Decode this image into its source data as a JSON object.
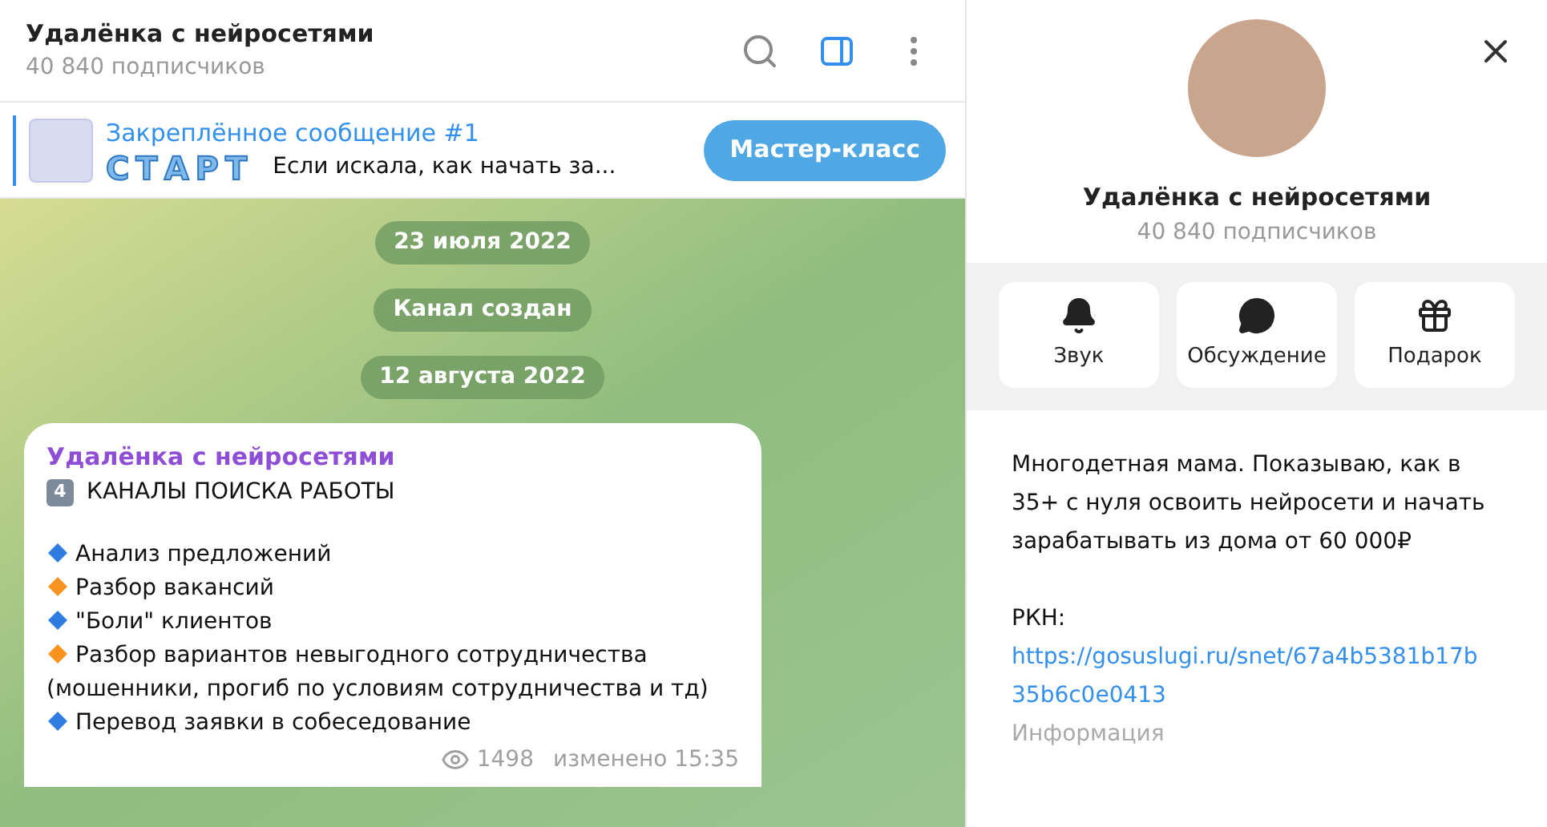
{
  "header": {
    "title": "Удалёнка с нейросетями",
    "subtitle": "40 840 подписчиков",
    "side_panel_open": true
  },
  "pinned": {
    "title": "Закреплённое сообщение #1",
    "start_word": "СТАРТ",
    "preview": "Если искала, как начать за...",
    "button": "Мастер-класс"
  },
  "service_messages": [
    "23 июля 2022",
    "Канал создан",
    "12 августа 2022"
  ],
  "message": {
    "author": "Удалёнка с нейросетями",
    "keycap": "4",
    "heading": "КАНАЛЫ ПОИСКА РАБОТЫ",
    "items": [
      {
        "text": "Анализ предложений",
        "color": "#2f7de1"
      },
      {
        "text": "Разбор вакансий",
        "color": "#f7931e"
      },
      {
        "text": "\"Боли\" клиентов",
        "color": "#2f7de1"
      },
      {
        "text": "Разбор вариантов невыгодного сотрудничества (мошенники, прогиб по условиям сотрудничества и тд)",
        "color": "#f7931e"
      },
      {
        "text": "Перевод заявки в собеседование",
        "color": "#2f7de1"
      }
    ],
    "views": "1498",
    "edited": "изменено 15:35"
  },
  "profile": {
    "name": "Удалёнка с нейросетями",
    "subtitle": "40 840 подписчиков",
    "actions": [
      {
        "kind": "bell",
        "label": "Звук"
      },
      {
        "kind": "chat",
        "label": "Обсуждение"
      },
      {
        "kind": "gift",
        "label": "Подарок"
      }
    ],
    "description": "Многодетная мама. Показываю, как в 35+ с нуля освоить нейросети и начать зарабатывать из дома от 60 000₽",
    "rkn_label": "РКН:",
    "link": "https://gosuslugi.ru/snet/67a4b5381b17b35b6c0e0413",
    "info_caption": "Информация"
  }
}
